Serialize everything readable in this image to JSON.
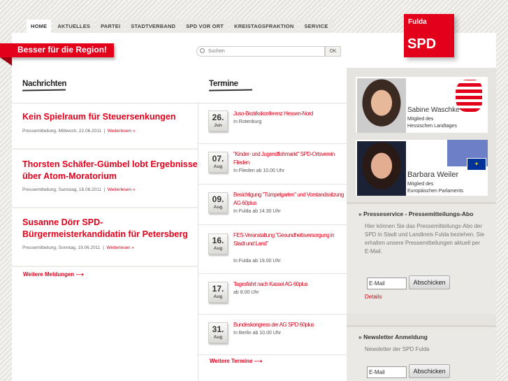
{
  "nav": [
    "HOME",
    "AKTUELLES",
    "PARTEI",
    "STADTVERBAND",
    "SPD VOR ORT",
    "KREISTAGSFRAKTION",
    "SERVICE"
  ],
  "banner": "Besser für die Region!",
  "search": {
    "placeholder": "Suchen",
    "button": "OK"
  },
  "logo": {
    "top": "Fulda",
    "main": "SPD"
  },
  "colors": {
    "accent": "#e2001a"
  },
  "news": {
    "heading": "Nachrichten",
    "items": [
      {
        "title": "Kein Spielraum für Steuersenkungen",
        "meta": "Pressemitteilung, Mittwoch, 22.06.2011",
        "link": "Weiterlesen »"
      },
      {
        "title": "Thorsten Schäfer-Gümbel lobt Ergebnisse über Atom-Moratorium",
        "meta": "Pressemitteilung, Samstag, 18.06.2011",
        "link": "Weiterlesen »"
      },
      {
        "title": "Susanne Dörr SPD-Bürgermeisterkandidatin für Petersberg",
        "meta": "Pressemitteilung, Sonntag, 19.06.2011",
        "link": "Weiterlesen »"
      }
    ],
    "more": "Weitere Meldungen ⟶"
  },
  "events": {
    "heading": "Termine",
    "items": [
      {
        "day": "26.",
        "month": "Jun",
        "title": "Juso-Bezirkskonferenz Hessen-Nord",
        "where": "In Rotenburg"
      },
      {
        "day": "07.",
        "month": "Aug",
        "title": "\"Kinder- und Jugendflohmarkt\" SPD-Ortsverein Flieden",
        "where": "In Flieden ab 10.00 Uhr"
      },
      {
        "day": "09.",
        "month": "Aug",
        "title": "Besichtigung \"Tümpelgarten\" und Vorstandssitzung AG 60plus",
        "where": "In Fulda ab 14.30 Uhr"
      },
      {
        "day": "16.",
        "month": "Aug",
        "title": "FES-Veranstaltung \"Gesundheitsversorgung in Stadt und Land\"",
        "where": "In Fulda ab 19.00 Uhr"
      },
      {
        "day": "17.",
        "month": "Aug",
        "title": "Tagesfahrt nach Kassel AG 60plus",
        "where": "ab 8.00 Uhr"
      },
      {
        "day": "31.",
        "month": "Aug",
        "title": "Bundeskongress der AG SPD 60plus",
        "where": "In Berlin ab 10.00 Uhr"
      }
    ],
    "more": "Weitere Termine ⟶"
  },
  "sidebar": {
    "cards": [
      {
        "name": "Sabine Waschke",
        "role1": "Mitglied des",
        "role2": "Hessischen Landtages"
      },
      {
        "name": "Barbara Weiler",
        "role1": "Mitglied des",
        "role2": "Europäischen Parlaments"
      }
    ],
    "press": {
      "title": "» Presseservice - Pressemitteilungs-Abo",
      "text": "Hier können Sie das Pressemitteilungs-Abo der SPD in Stadt und Landkreis Fulda beziehen. Sie erhalten unsere Pressemitteilungen aktuell per E-Mail.",
      "input": "E-Mail",
      "button": "Abschicken",
      "details": "Details"
    },
    "newsletter": {
      "title": "» Newsletter Anmeldung",
      "text": "Newsletter der SPD Fulda",
      "input": "E-Mail",
      "button": "Abschicken"
    }
  }
}
